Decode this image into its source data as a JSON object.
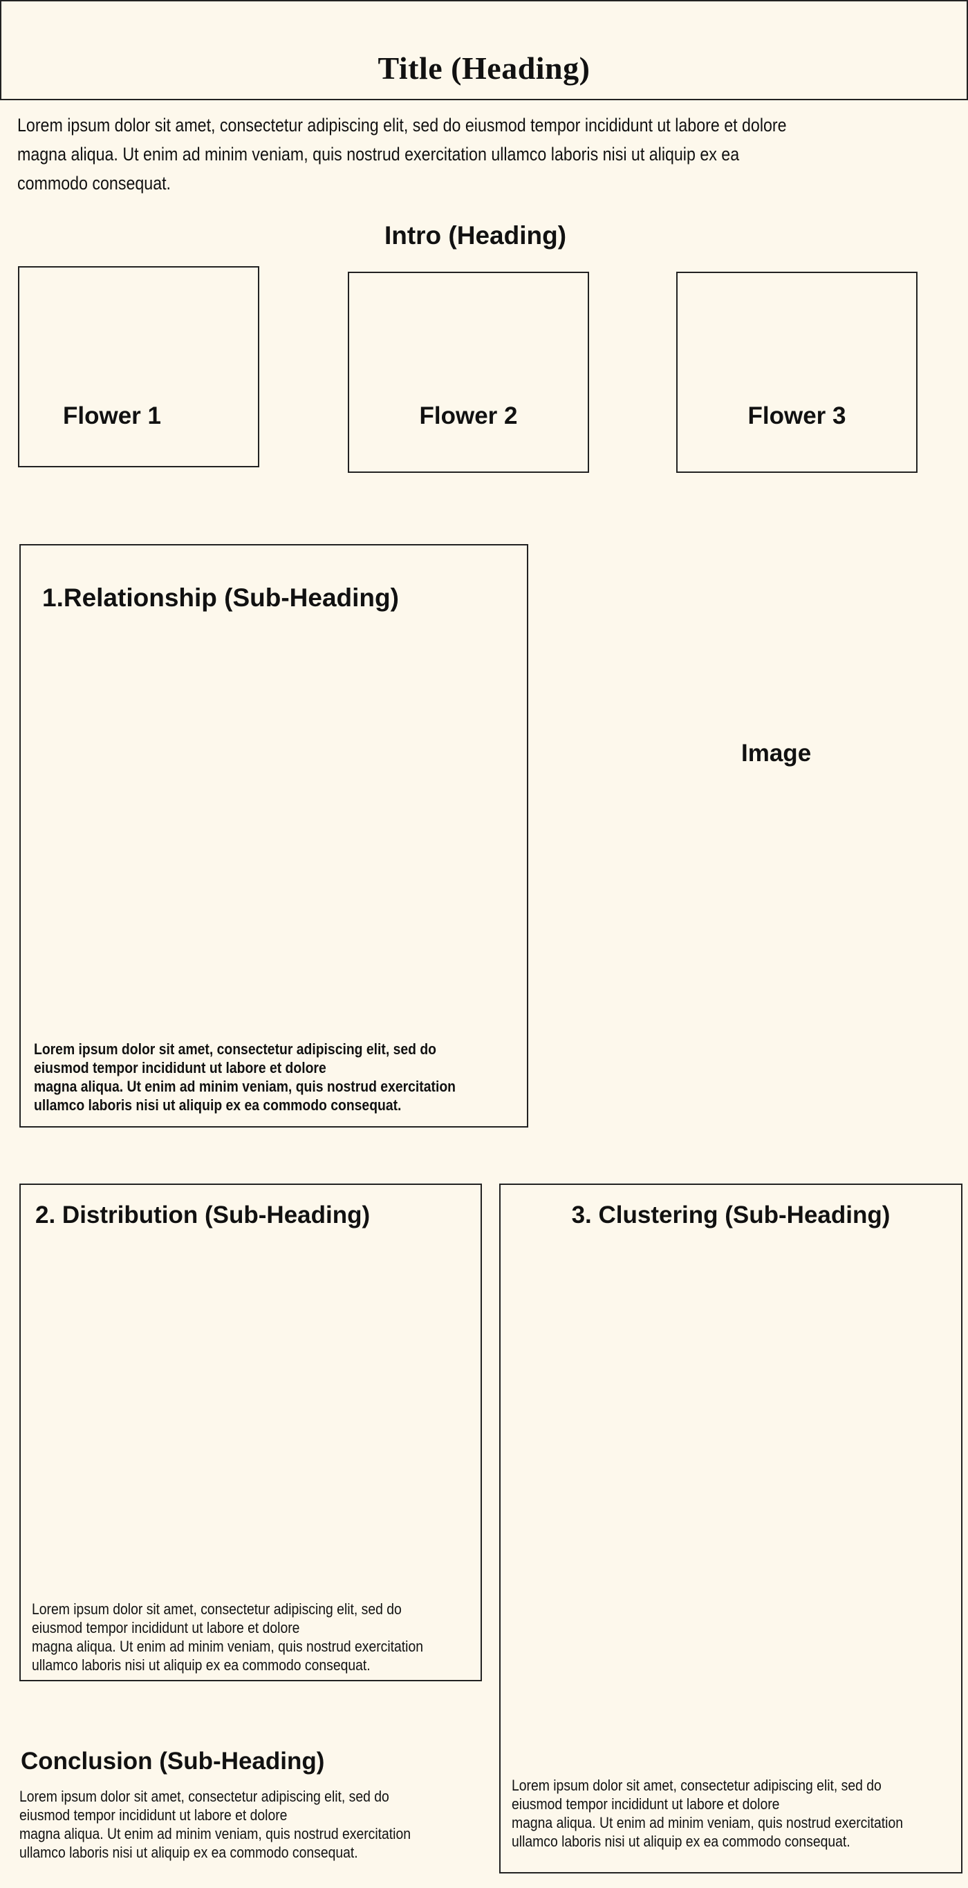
{
  "title": "Title (Heading)",
  "intro_paragraph": [
    "Lorem ipsum dolor sit amet, consectetur adipiscing elit, sed do eiusmod tempor incididunt ut labore et dolore",
    "magna aliqua. Ut enim ad minim veniam, quis nostrud exercitation ullamco laboris nisi ut aliquip ex ea",
    "commodo consequat."
  ],
  "intro_heading": "Intro (Heading)",
  "flowers": [
    "Flower 1",
    "Flower 2",
    "Flower 3"
  ],
  "relationship": {
    "heading": "1.Relationship (Sub-Heading)",
    "text": [
      "Lorem ipsum dolor sit amet, consectetur adipiscing elit, sed do",
      "eiusmod tempor incididunt ut labore et dolore",
      "magna aliqua. Ut enim ad minim veniam, quis nostrud exercitation",
      "ullamco laboris nisi ut aliquip ex ea commodo consequat."
    ]
  },
  "image_label": "Image",
  "distribution": {
    "heading": "2. Distribution (Sub-Heading)",
    "text": [
      "Lorem ipsum dolor sit amet, consectetur adipiscing elit, sed do",
      "eiusmod tempor incididunt ut labore et dolore",
      "magna aliqua. Ut enim ad minim veniam, quis nostrud exercitation",
      "ullamco laboris nisi ut aliquip ex ea commodo consequat."
    ]
  },
  "clustering": {
    "heading": "3. Clustering (Sub-Heading)",
    "text": [
      "Lorem ipsum dolor sit amet, consectetur adipiscing elit, sed do",
      "eiusmod tempor incididunt ut labore et dolore",
      "magna aliqua. Ut enim ad minim veniam, quis nostrud exercitation",
      "ullamco laboris nisi ut aliquip ex ea commodo consequat."
    ]
  },
  "conclusion": {
    "heading": "Conclusion (Sub-Heading)",
    "text": [
      "Lorem ipsum dolor sit amet, consectetur adipiscing elit, sed do",
      "eiusmod tempor incididunt ut labore et dolore",
      "magna aliqua. Ut enim ad minim veniam, quis nostrud exercitation",
      "ullamco laboris nisi ut aliquip ex ea commodo consequat."
    ]
  },
  "colors": {
    "background": "#fdf8ec",
    "border": "#222222",
    "text": "#111111"
  }
}
